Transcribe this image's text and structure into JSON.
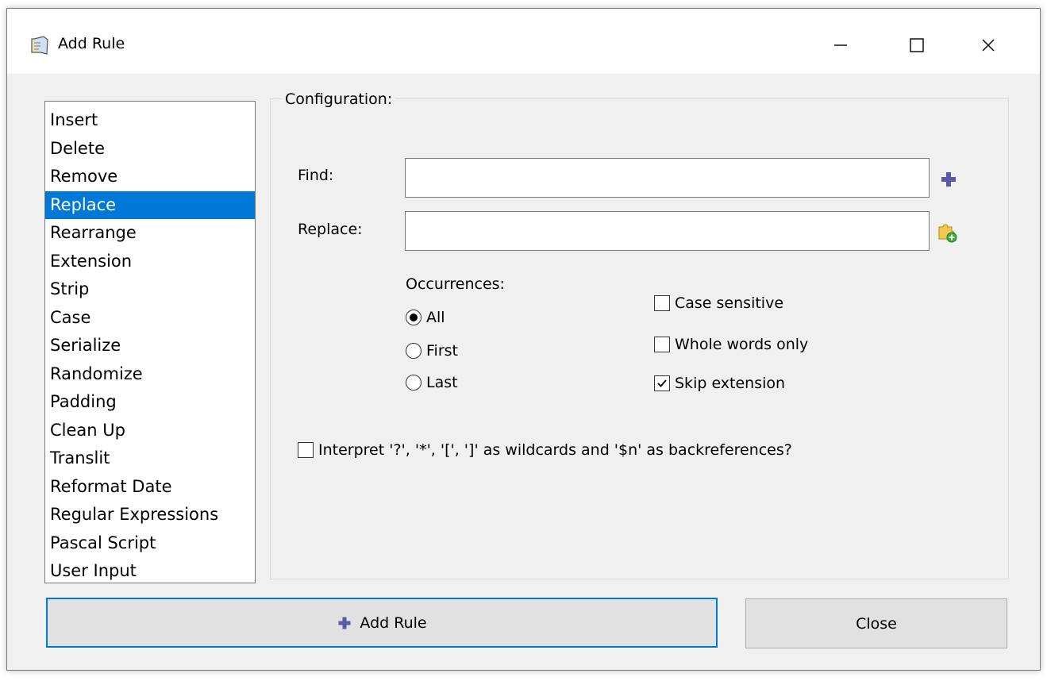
{
  "window": {
    "title": "Add Rule"
  },
  "rules": [
    {
      "label": "Insert",
      "selected": false
    },
    {
      "label": "Delete",
      "selected": false
    },
    {
      "label": "Remove",
      "selected": false
    },
    {
      "label": "Replace",
      "selected": true
    },
    {
      "label": "Rearrange",
      "selected": false
    },
    {
      "label": "Extension",
      "selected": false
    },
    {
      "label": "Strip",
      "selected": false
    },
    {
      "label": "Case",
      "selected": false
    },
    {
      "label": "Serialize",
      "selected": false
    },
    {
      "label": "Randomize",
      "selected": false
    },
    {
      "label": "Padding",
      "selected": false
    },
    {
      "label": "Clean Up",
      "selected": false
    },
    {
      "label": "Translit",
      "selected": false
    },
    {
      "label": "Reformat Date",
      "selected": false
    },
    {
      "label": "Regular Expressions",
      "selected": false
    },
    {
      "label": "Pascal Script",
      "selected": false
    },
    {
      "label": "User Input",
      "selected": false
    }
  ],
  "config": {
    "legend": "Configuration:",
    "find_label": "Find:",
    "find_value": "",
    "replace_label": "Replace:",
    "replace_value": "",
    "occurrences_label": "Occurrences:",
    "occurrences": [
      {
        "label": "All",
        "checked": true
      },
      {
        "label": "First",
        "checked": false
      },
      {
        "label": "Last",
        "checked": false
      }
    ],
    "options": [
      {
        "label": "Case sensitive",
        "checked": false
      },
      {
        "label": "Whole words only",
        "checked": false
      },
      {
        "label": "Skip extension",
        "checked": true
      }
    ],
    "wildcards": {
      "label": "Interpret '?', '*', '[', ']' as wildcards and '$n' as backreferences?",
      "checked": false
    }
  },
  "buttons": {
    "add_rule": "Add Rule",
    "close": "Close"
  },
  "colors": {
    "selection": "#0078d7",
    "plus_icon": "#5a5aa6",
    "window_bg": "#f0f0f0"
  }
}
